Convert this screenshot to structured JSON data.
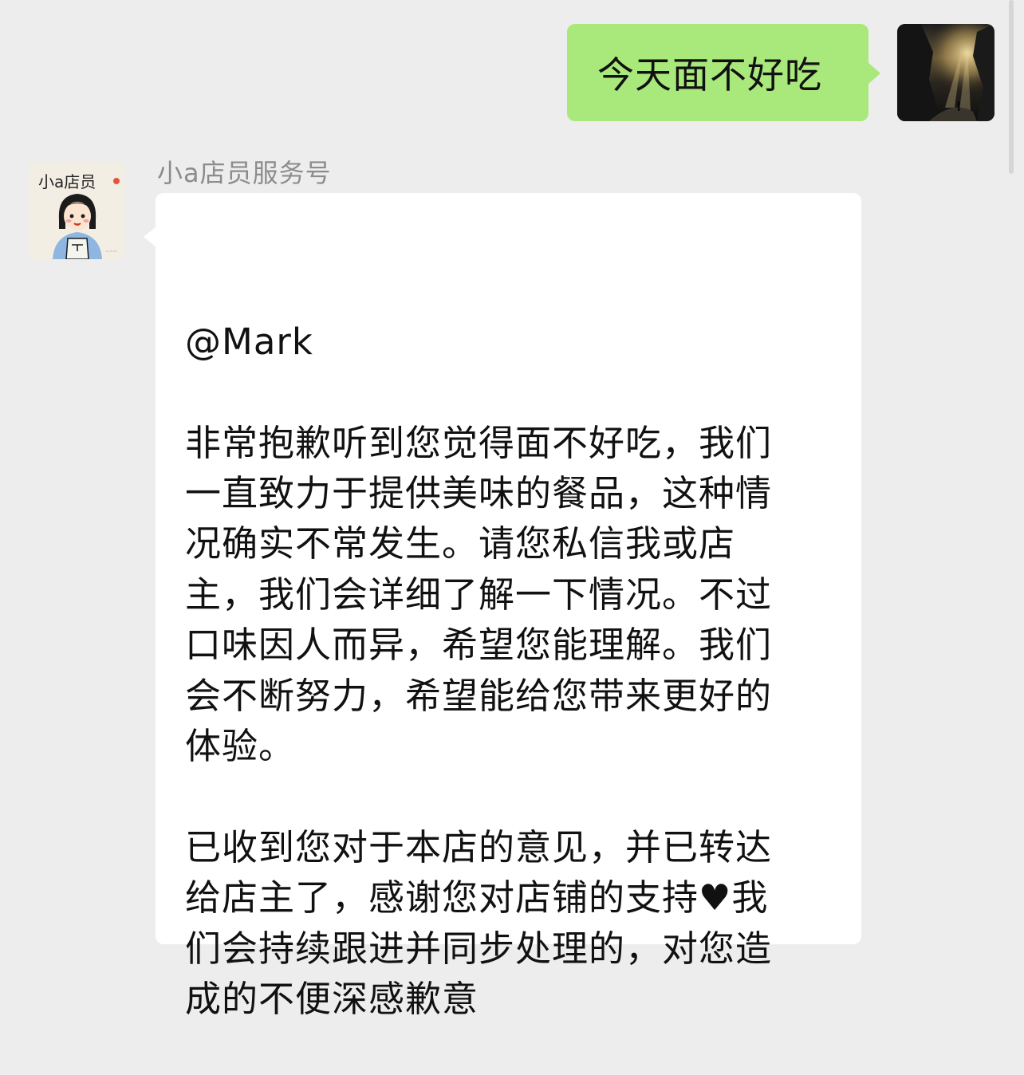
{
  "chat": {
    "outgoing": {
      "text": "今天面不好吃"
    },
    "incoming": {
      "sender": "小a店员服务号",
      "avatar_label": "小a店员",
      "text": "@Mark\n\n非常抱歉听到您觉得面不好吃，我们\n一直致力于提供美味的餐品，这种情\n况确实不常发生。请您私信我或店\n主，我们会详细了解一下情况。不过\n口味因人而异，希望您能理解。我们\n会不断努力，希望能给您带来更好的\n体验。\n\n已收到您对于本店的意见，并已转达\n给店主了，感谢您对店铺的支持♥我\n们会持续跟进并同步处理的，对您造\n成的不便深感歉意"
    }
  },
  "colors": {
    "background": "#ededed",
    "outgoing_bubble": "#a9e87b",
    "incoming_bubble": "#ffffff",
    "sender_name": "#8c8c8c"
  },
  "icons": {
    "my_avatar": "mountain-light-photo-avatar",
    "bot_avatar": "cartoon-clerk-girl-avatar"
  }
}
